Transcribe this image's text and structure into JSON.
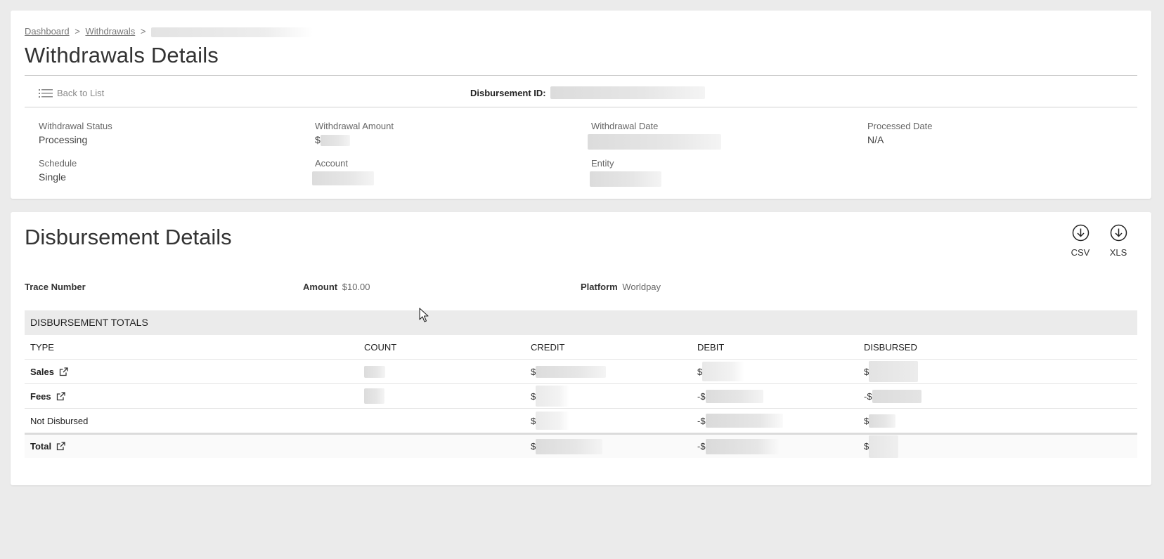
{
  "breadcrumb": {
    "items": [
      "Dashboard",
      "Withdrawals"
    ],
    "separator": ">"
  },
  "page_title": "Withdrawals Details",
  "toolbar": {
    "back_label": "Back to List",
    "disbursement_id_label": "Disbursement ID:"
  },
  "withdrawal": {
    "status_label": "Withdrawal Status",
    "status_value": "Processing",
    "amount_label": "Withdrawal Amount",
    "amount_prefix": "$",
    "date_label": "Withdrawal Date",
    "processed_label": "Processed Date",
    "processed_value": "N/A",
    "schedule_label": "Schedule",
    "schedule_value": "Single",
    "account_label": "Account",
    "entity_label": "Entity"
  },
  "disbursement": {
    "title": "Disbursement Details",
    "csv_label": "CSV",
    "xls_label": "XLS",
    "trace_label": "Trace Number",
    "amount_label": "Amount",
    "amount_value": "$10.00",
    "platform_label": "Platform",
    "platform_value": "Worldpay"
  },
  "totals": {
    "heading": "DISBURSEMENT TOTALS",
    "columns": [
      "TYPE",
      "COUNT",
      "CREDIT",
      "DEBIT",
      "DISBURSED"
    ],
    "rows": [
      {
        "type": "Sales",
        "credit_prefix": "$",
        "debit_prefix": "$",
        "disbursed_prefix": "$"
      },
      {
        "type": "Fees",
        "credit_prefix": "$",
        "debit_prefix": "-$",
        "disbursed_prefix": "-$"
      },
      {
        "type": "Not Disbursed",
        "credit_prefix": "$",
        "debit_prefix": "-$",
        "disbursed_prefix": "$"
      },
      {
        "type": "Total",
        "credit_prefix": "$",
        "debit_prefix": "-$",
        "disbursed_prefix": "$"
      }
    ]
  },
  "colors": {
    "background": "#ebebeb",
    "card": "#ffffff",
    "table_header": "#ebebeb",
    "text": "#333333"
  },
  "icons": [
    "list-icon",
    "download-icon",
    "external-link-icon",
    "mouse-cursor-icon"
  ]
}
